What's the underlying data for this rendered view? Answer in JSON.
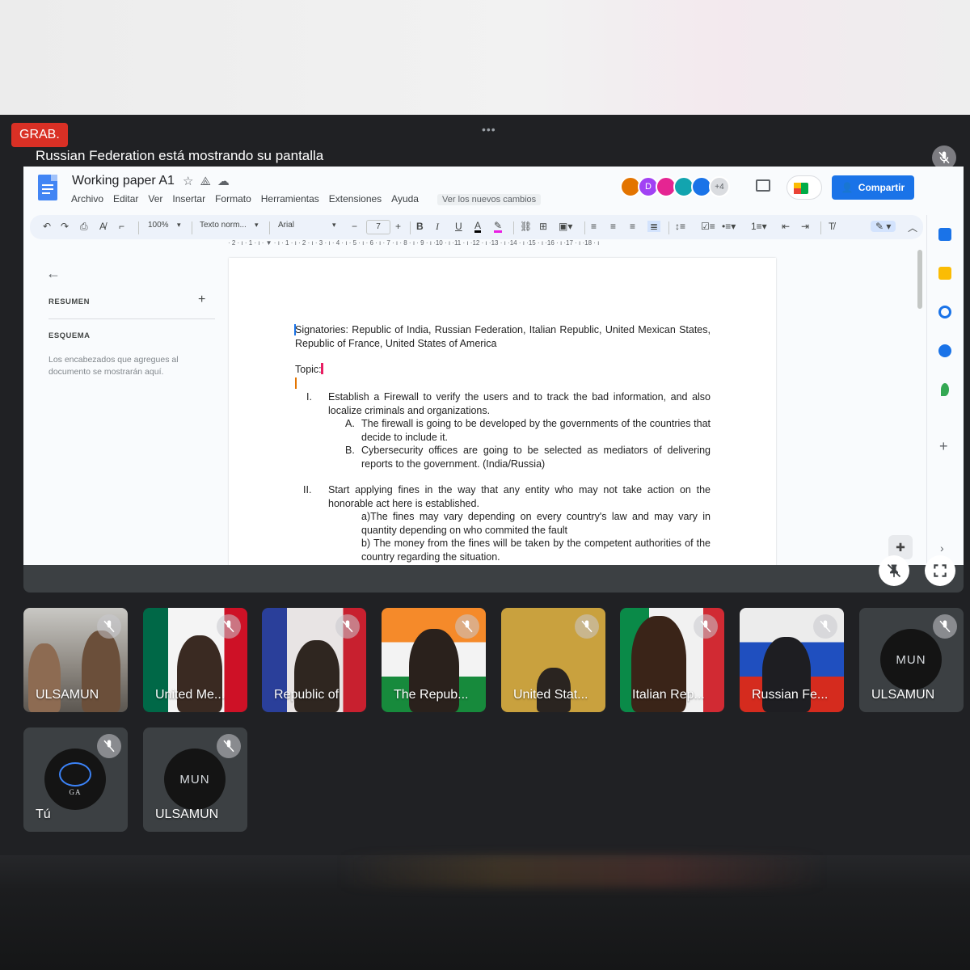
{
  "meeting": {
    "rec_label": "GRAB.",
    "share_banner": "Russian Federation está mostrando su pantalla",
    "more_dots": "•••"
  },
  "doc": {
    "title": "Working paper A1",
    "menu": [
      "Archivo",
      "Editar",
      "Ver",
      "Insertar",
      "Formato",
      "Herramientas",
      "Extensiones",
      "Ayuda"
    ],
    "changes_link": "Ver los nuevos cambios",
    "share_button": "Compartir",
    "avatars": [
      {
        "label": "",
        "color": "#e37400"
      },
      {
        "label": "D",
        "color": "#a142f4"
      },
      {
        "label": "",
        "color": "#e52592"
      },
      {
        "label": "",
        "color": "#12a4af"
      },
      {
        "label": "",
        "color": "#1a73e8"
      },
      {
        "label": "+4",
        "color": "#dadce0"
      }
    ],
    "toolbar": {
      "zoom": "100%",
      "style": "Texto norm...",
      "font": "Arial",
      "font_size": "7"
    },
    "ruler": "· 2 · ı · 1 · ı ·  ▼ · ı · 1 · ı · 2 · ı · 3 · ı · 4 · ı · 5 · ı · 6 · ı · 7 · ı · 8 · ı · 9 · ı ·10 · ı ·11 · ı ·12 · ı ·13 · ı ·14 · ı ·15 · ı ·16 · ı ·17 · ı ·18 · ı",
    "outline": {
      "summary_heading": "RESUMEN",
      "outline_heading": "ESQUEMA",
      "hint": "Los encabezados que agregues al documento se mostrarán aquí."
    },
    "body": {
      "signatories": "Signatories: Republic of India, Russian Federation, Italian Republic, United Mexican States, Republic of France, United States of America",
      "topic": "Topic:",
      "item1_num": "I.",
      "item1": "Establish a Firewall to verify the users and to track the bad information, and also localize criminals and organizations.",
      "item1a_num": "A.",
      "item1a": "The firewall is going to be developed by the governments of the countries that decide to include it.",
      "item1b_num": "B.",
      "item1b": "Cybersecurity offices are going to be selected as mediators of delivering reports to the government. (India/Russia)",
      "item2_num": "II.",
      "item2": "Start applying fines in the way that any entity who may not take action on the honorable act here is established.",
      "item2a": "a)The fines may vary depending on every country's law and may vary in quantity depending on who commited the fault",
      "item2b": "b) The money from the fines will be taken by the competent authorities of the country regarding the situation."
    }
  },
  "participants": [
    {
      "name": "ULSAMUN"
    },
    {
      "name": "United Me..."
    },
    {
      "name": "Republic of"
    },
    {
      "name": "The Repub..."
    },
    {
      "name": "United Stat..."
    },
    {
      "name": "Italian Rep..."
    },
    {
      "name": "Russian Fe..."
    },
    {
      "name": "ULSAMUN",
      "logo": "MUN"
    },
    {
      "name": "Tú",
      "logo_line1": "GA"
    },
    {
      "name": "ULSAMUN",
      "logo": "MUN"
    }
  ]
}
